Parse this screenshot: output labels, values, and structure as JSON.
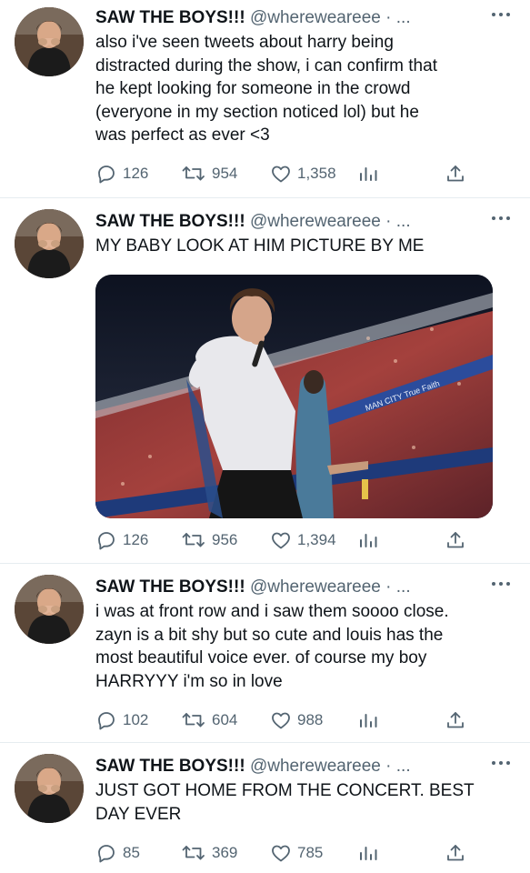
{
  "tweets": [
    {
      "name": "SAW THE BOYS!!!",
      "handle": "@whereweareee · ...",
      "text": "also i've seen tweets about harry being\ndistracted during the show, i can confirm that\nhe kept looking for someone in the crowd\n(everyone in my section noticed lol) but he\nwas perfect as ever <3",
      "replies": "126",
      "retweets": "954",
      "likes": "1,358"
    },
    {
      "name": "SAW THE BOYS!!!",
      "handle": "@whereweareee · ...",
      "text": "MY BABY LOOK AT HIM PICTURE BY ME",
      "replies": "126",
      "retweets": "956",
      "likes": "1,394",
      "media_banner_text": "MAN CITY True Faith"
    },
    {
      "name": "SAW THE BOYS!!!",
      "handle": "@whereweareee · ...",
      "text": "i was at front row and i saw them soooo close.\nzayn is a bit shy but so cute and louis has the\nmost beautiful voice ever. of course my boy\nHARRYYY i'm so in love",
      "replies": "102",
      "retweets": "604",
      "likes": "988"
    },
    {
      "name": "SAW THE BOYS!!!",
      "handle": "@whereweareee · ...",
      "text": "JUST GOT HOME FROM THE CONCERT. BEST\nDAY EVER",
      "replies": "85",
      "retweets": "369",
      "likes": "785"
    }
  ],
  "colors": {
    "text": "#0f1419",
    "secondary": "#536471",
    "divider": "#e6ecf0"
  },
  "icons": [
    "reply-icon",
    "retweet-icon",
    "like-icon",
    "analytics-icon",
    "share-icon",
    "more-icon"
  ]
}
